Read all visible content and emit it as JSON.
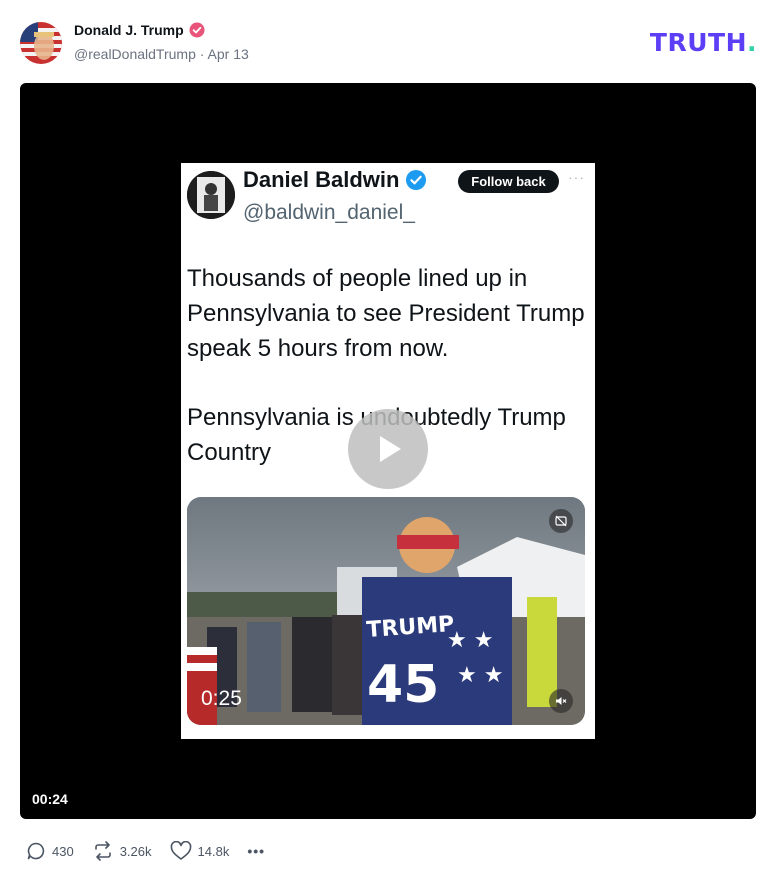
{
  "post": {
    "author_name": "Donald J. Trump",
    "handle": "@realDonaldTrump",
    "date": "Apr 13",
    "meta_line": "@realDonaldTrump · Apr 13",
    "brand": {
      "logo_text": "TRUTH",
      "logo_dot": ".",
      "primary_color": "#5b3ef5",
      "accent_color": "#2fd3a7"
    },
    "verified_icon": "verified-badge-icon"
  },
  "video": {
    "timestamp": "00:24",
    "embedded_tweet": {
      "author_name": "Daniel Baldwin",
      "handle": "@baldwin_daniel_",
      "follow_label": "Follow back",
      "more_label": "···",
      "text_paragraphs": [
        "Thousands of people lined up in Pennsylvania to see President Trump speak 5 hours from now.",
        "Pennsylvania is undoubtedly Trump Country"
      ],
      "media_time": "0:25"
    }
  },
  "actions": {
    "replies": "430",
    "retruths": "3.26k",
    "likes": "14.8k",
    "more_label": "•••"
  }
}
